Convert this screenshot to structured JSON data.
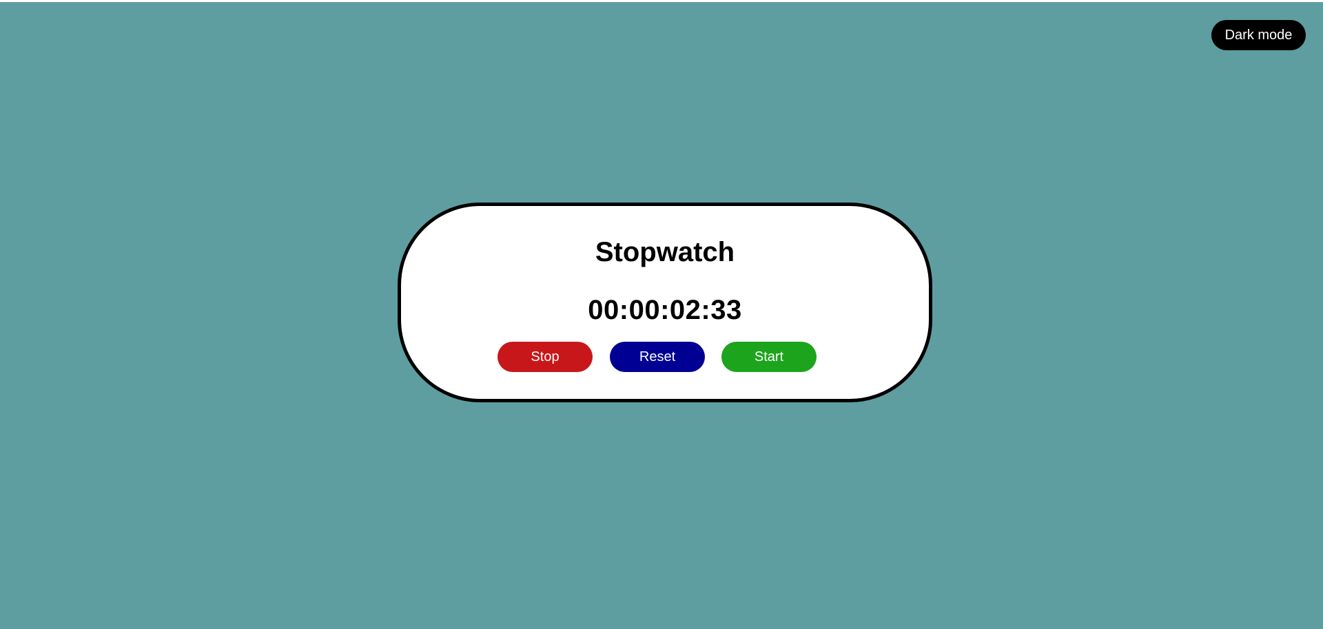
{
  "header": {
    "dark_mode_label": "Dark mode"
  },
  "stopwatch": {
    "title": "Stopwatch",
    "time": "00:00:02:33",
    "buttons": {
      "stop_label": "Stop",
      "reset_label": "Reset",
      "start_label": "Start"
    }
  },
  "colors": {
    "background": "#5f9ea0",
    "card": "#ffffff",
    "card_border": "#000000",
    "dark_mode_button": "#000000",
    "stop_button": "#c8171a",
    "reset_button": "#000092",
    "start_button": "#1ca41c"
  }
}
